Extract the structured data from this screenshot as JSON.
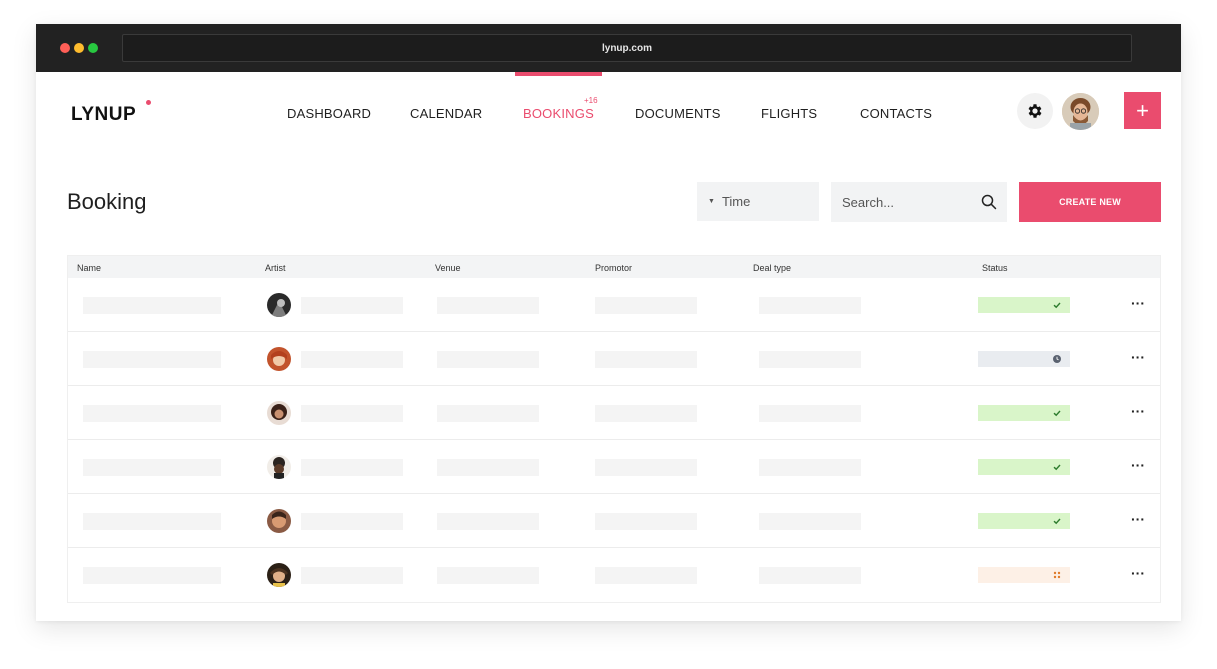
{
  "browser": {
    "url": "lynup.com"
  },
  "brand": {
    "name": "LYNUP",
    "accent": "#ea4c6e"
  },
  "nav": {
    "items": [
      {
        "label": "DASHBOARD",
        "active": false
      },
      {
        "label": "CALENDAR",
        "active": false
      },
      {
        "label": "BOOKINGS",
        "active": true,
        "badge": "+16"
      },
      {
        "label": "DOCUMENTS",
        "active": false
      },
      {
        "label": "FLIGHTS",
        "active": false
      },
      {
        "label": "CONTACTS",
        "active": false
      }
    ]
  },
  "header_actions": {
    "settings_icon": "gear-icon",
    "avatar_icon": "avatar",
    "add_label": "+"
  },
  "page": {
    "title": "Booking"
  },
  "filters": {
    "time_label": "Time",
    "search_placeholder": "Search...",
    "create_label": "CREATE NEW"
  },
  "table": {
    "columns": [
      "Name",
      "Artist",
      "Venue",
      "Promotor",
      "Deal type",
      "Status"
    ],
    "rows": [
      {
        "status": "confirmed",
        "status_icon": "check-icon",
        "status_color": "#d9f5c9",
        "more": "···"
      },
      {
        "status": "pending",
        "status_icon": "clock-icon",
        "status_color": "#e9ecf0",
        "more": "···"
      },
      {
        "status": "confirmed",
        "status_icon": "check-icon",
        "status_color": "#d9f5c9",
        "more": "···"
      },
      {
        "status": "confirmed",
        "status_icon": "check-icon",
        "status_color": "#d9f5c9",
        "more": "···"
      },
      {
        "status": "confirmed",
        "status_icon": "check-icon",
        "status_color": "#d9f5c9",
        "more": "···"
      },
      {
        "status": "in-progress",
        "status_icon": "dots-icon",
        "status_color": "#fdf0e6",
        "more": "···"
      }
    ]
  }
}
